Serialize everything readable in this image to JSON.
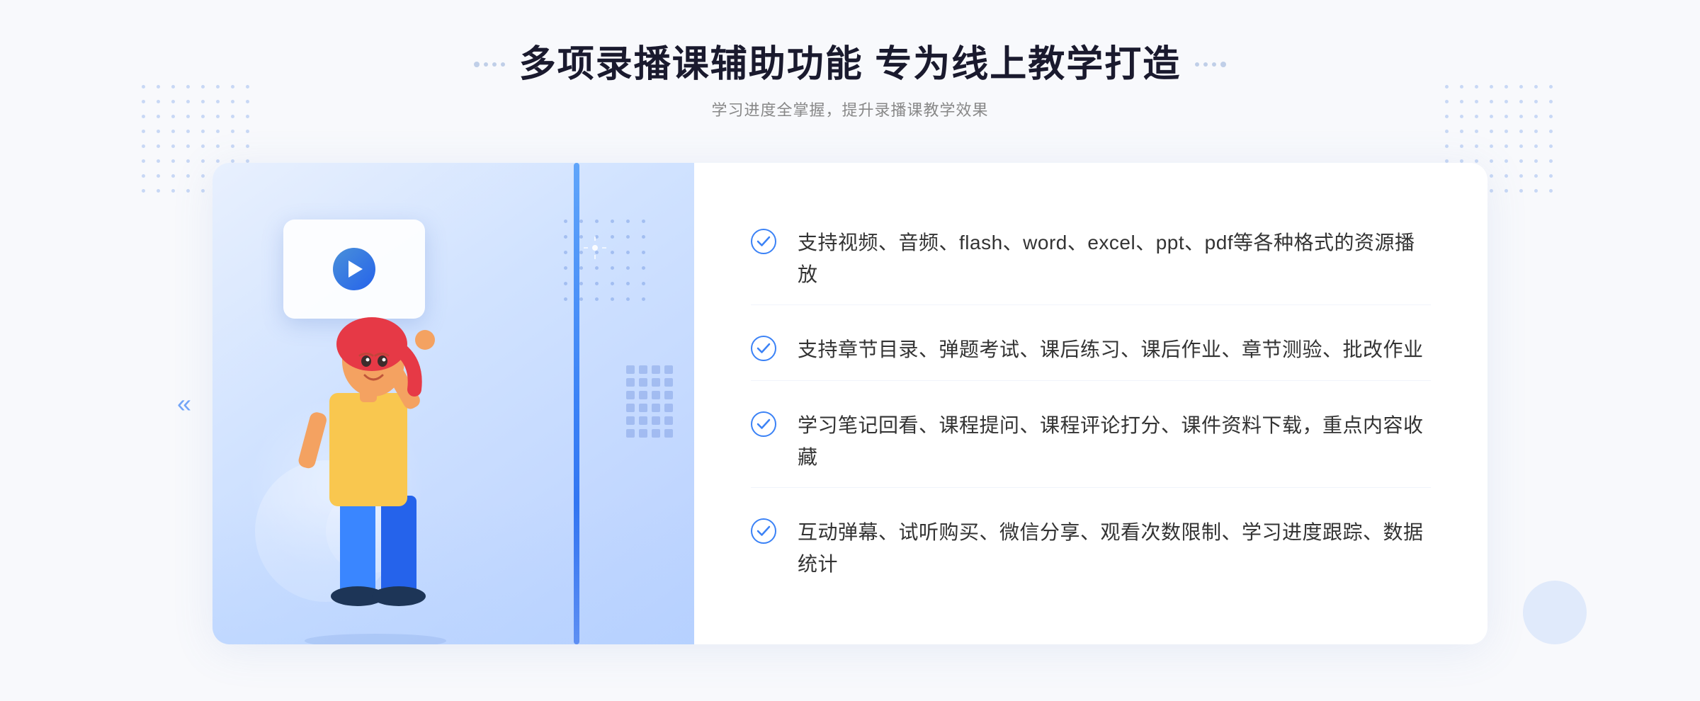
{
  "page": {
    "background_color": "#f8f9fc"
  },
  "header": {
    "title": "多项录播课辅助功能 专为线上教学打造",
    "subtitle": "学习进度全掌握，提升录播课教学效果"
  },
  "features": [
    {
      "id": "feature-1",
      "text": "支持视频、音频、flash、word、excel、ppt、pdf等各种格式的资源播放"
    },
    {
      "id": "feature-2",
      "text": "支持章节目录、弹题考试、课后练习、课后作业、章节测验、批改作业"
    },
    {
      "id": "feature-3",
      "text": "学习笔记回看、课程提问、课程评论打分、课件资料下载，重点内容收藏"
    },
    {
      "id": "feature-4",
      "text": "互动弹幕、试听购买、微信分享、观看次数限制、学习进度跟踪、数据统计"
    }
  ],
  "decoration": {
    "chevron_left": "«",
    "play_button_aria": "play-video"
  },
  "colors": {
    "primary": "#3b82f6",
    "primary_dark": "#2563eb",
    "text_dark": "#1a1a2e",
    "text_light": "#888888",
    "check_color": "#3b82f6",
    "illustration_bg_start": "#e8f0fe",
    "illustration_bg_end": "#b8d0ff"
  }
}
